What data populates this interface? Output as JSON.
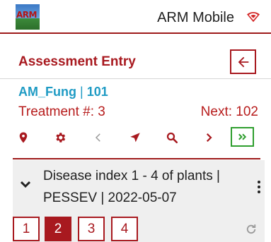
{
  "app": {
    "logo_text": "ARM",
    "title": "ARM Mobile"
  },
  "header": {
    "title": "Assessment Entry"
  },
  "study": {
    "name": "AM_Fung",
    "separator": "|",
    "number": "101"
  },
  "treatment": {
    "label": "Treatment #: 3",
    "next": "Next: 102"
  },
  "toolbar": {
    "icons": [
      "location-pin-icon",
      "gear-icon",
      "previous-icon",
      "navigate-icon",
      "search-icon",
      "next-icon",
      "fast-forward-icon"
    ]
  },
  "assessment": {
    "line1": "Disease index 1 - 4 of plants |",
    "line2": "PESSEV | 2022-05-07",
    "plants": [
      "1",
      "2",
      "3",
      "4"
    ],
    "selected_plant": "2"
  },
  "colors": {
    "brand_red": "#a8191f",
    "study_blue": "#1f9bc4",
    "accent_green": "#2e9e2e"
  }
}
